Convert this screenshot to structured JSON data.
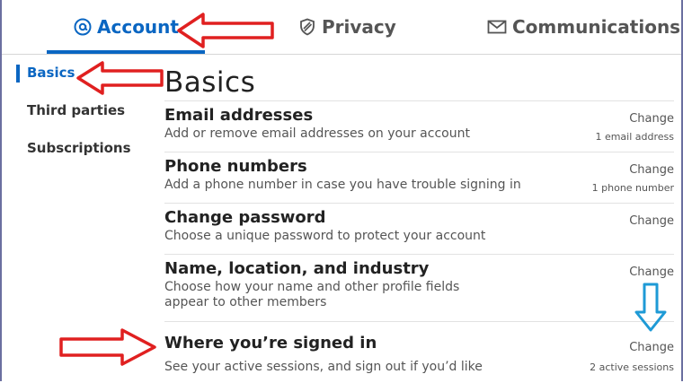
{
  "tabs": [
    {
      "label": "Account",
      "icon": "at-sign-icon",
      "active": true
    },
    {
      "label": "Privacy",
      "icon": "shield-icon",
      "active": false
    },
    {
      "label": "Communications",
      "icon": "envelope-icon",
      "active": false
    }
  ],
  "sidebar": {
    "items": [
      {
        "label": "Basics",
        "active": true
      },
      {
        "label": "Third parties",
        "active": false
      },
      {
        "label": "Subscriptions",
        "active": false
      }
    ]
  },
  "main": {
    "title": "Basics",
    "rows": [
      {
        "title": "Email addresses",
        "desc": "Add or remove email addresses on your account",
        "action": "Change",
        "meta": "1 email address"
      },
      {
        "title": "Phone numbers",
        "desc": "Add a phone number in case you have trouble signing in",
        "action": "Change",
        "meta": "1 phone number"
      },
      {
        "title": "Change password",
        "desc": "Choose a unique password to protect your account",
        "action": "Change",
        "meta": ""
      },
      {
        "title": "Name, location, and industry",
        "desc": "Choose how your name and other profile fields appear to other members",
        "action": "Change",
        "meta": ""
      },
      {
        "title": "Where you’re signed in",
        "desc": "See your active sessions, and sign out if you’d like",
        "action": "Change",
        "meta": "2 active sessions"
      }
    ]
  },
  "colors": {
    "accent": "#0a66c2",
    "annotation_red": "#e02020",
    "annotation_blue": "#1e9ad6"
  }
}
